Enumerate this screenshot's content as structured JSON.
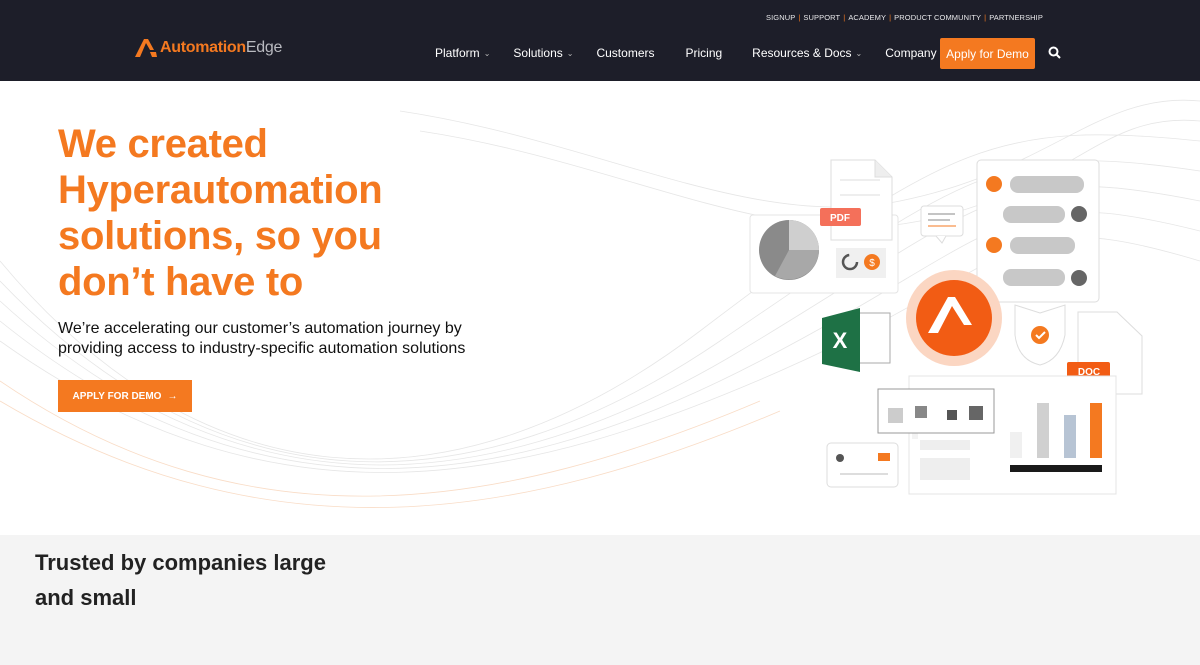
{
  "header": {
    "top_links": [
      "SIGNUP",
      "SUPPORT",
      "ACADEMY",
      "PRODUCT COMMUNITY",
      "PARTNERSHIP"
    ],
    "logo": {
      "part1": "Automation",
      "part2": "Edge"
    },
    "menu": [
      {
        "label": "Platform",
        "dropdown": true
      },
      {
        "label": "Solutions",
        "dropdown": true
      },
      {
        "label": "Customers",
        "dropdown": false
      },
      {
        "label": "Pricing",
        "dropdown": false
      },
      {
        "label": "Resources & Docs",
        "dropdown": true
      },
      {
        "label": "Company",
        "dropdown": true
      }
    ],
    "demo_button": "Apply for Demo",
    "search_icon": "search-icon"
  },
  "hero": {
    "title": "We created Hyperautomation solutions, so you don’t have to",
    "subtitle": "We’re accelerating our customer’s automation journey by providing access to industry-specific automation solutions",
    "cta": "APPLY FOR DEMO",
    "illustration": {
      "pdf_label": "PDF",
      "doc_label": "DOC",
      "excel_letter": "X",
      "dollar": "$"
    }
  },
  "trusted": {
    "title": "Trusted by companies large and small"
  },
  "colors": {
    "accent": "#f47920",
    "nav_bg": "#1d1e29",
    "section_bg": "#f4f4f4"
  }
}
